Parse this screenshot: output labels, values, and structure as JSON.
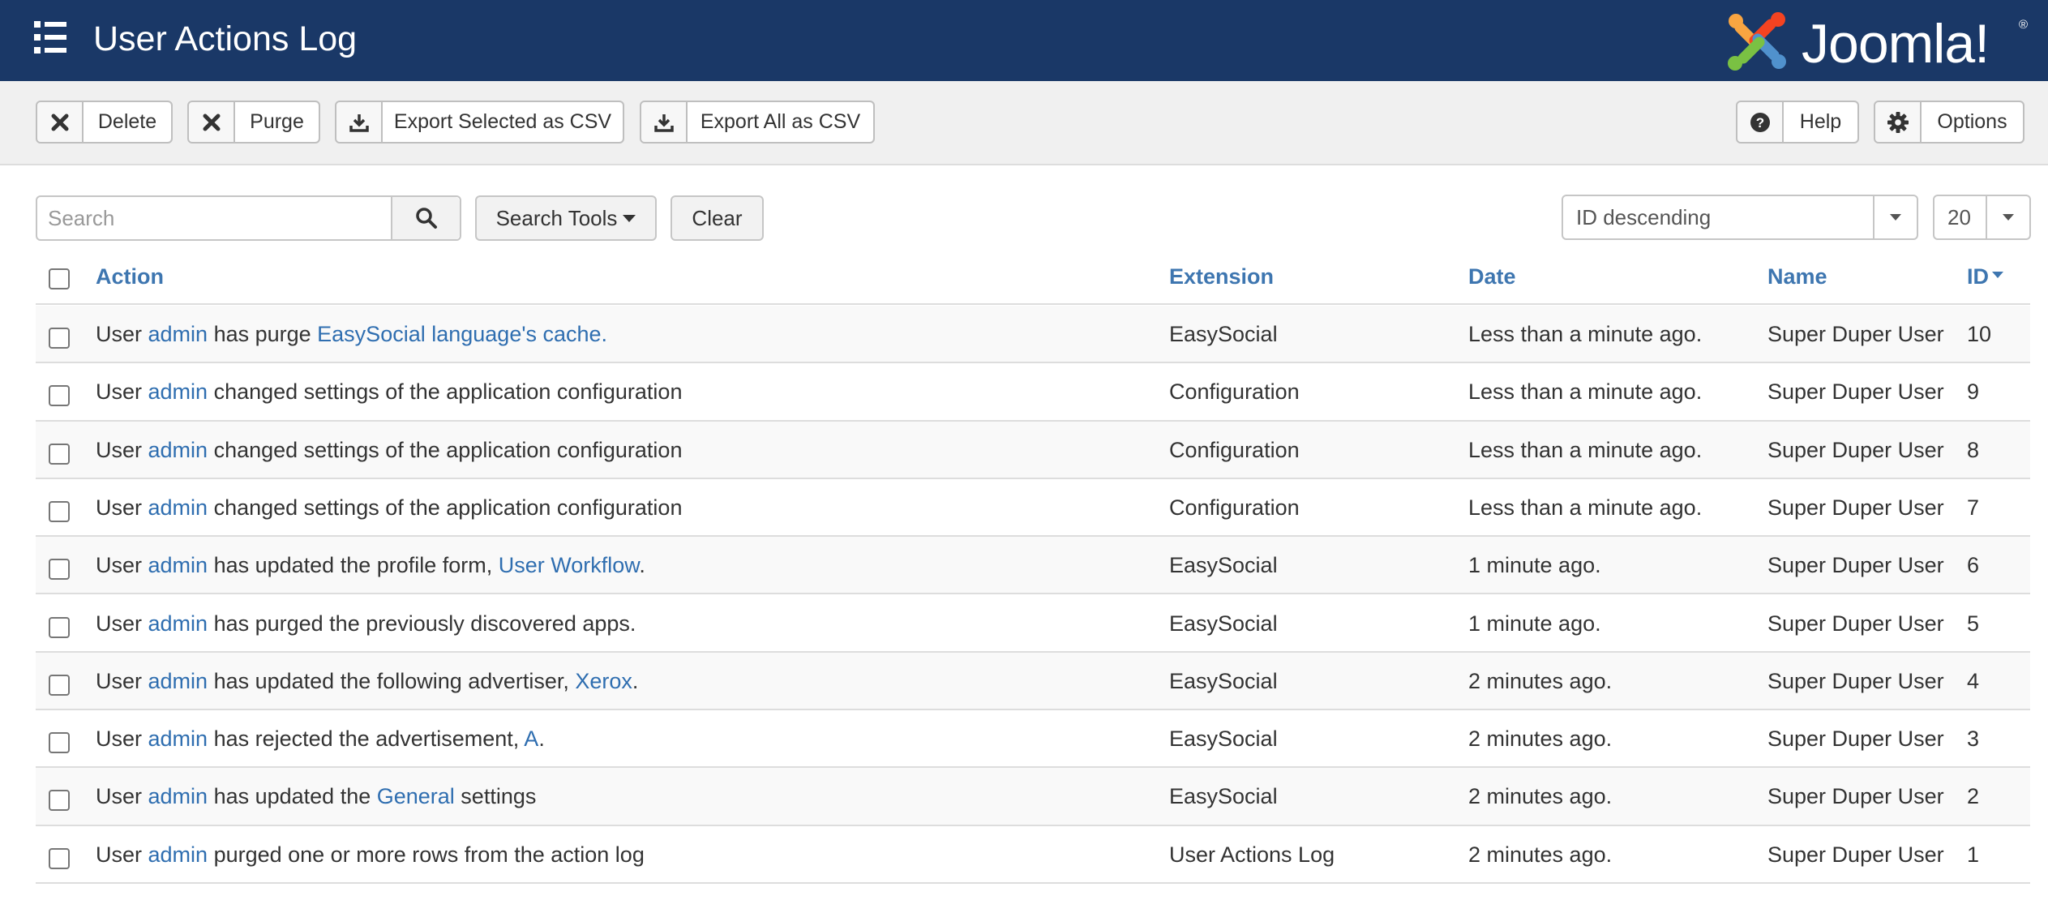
{
  "header": {
    "title": "User Actions Log",
    "brand": "Joomla!",
    "brand_mark": "®",
    "bg_color": "#1a3867"
  },
  "toolbar": {
    "delete_label": "Delete",
    "purge_label": "Purge",
    "export_selected_label": "Export Selected as CSV",
    "export_all_label": "Export All as CSV",
    "help_label": "Help",
    "options_label": "Options"
  },
  "filters": {
    "search_placeholder": "Search",
    "search_tools_label": "Search Tools",
    "clear_label": "Clear",
    "ordering_value": "ID descending",
    "limit_value": "20"
  },
  "table": {
    "columns": {
      "action": "Action",
      "extension": "Extension",
      "date": "Date",
      "name": "Name",
      "id": "ID"
    },
    "link_color": "#2f6eb0",
    "rows": [
      {
        "action": [
          {
            "t": "User "
          },
          {
            "t": "admin",
            "link": true
          },
          {
            "t": " has purge "
          },
          {
            "t": "EasySocial language's cache.",
            "link": true
          }
        ],
        "extension": "EasySocial",
        "date": "Less than a minute ago.",
        "name": "Super Duper User",
        "id": "10"
      },
      {
        "action": [
          {
            "t": "User "
          },
          {
            "t": "admin",
            "link": true
          },
          {
            "t": " changed settings of the application configuration"
          }
        ],
        "extension": "Configuration",
        "date": "Less than a minute ago.",
        "name": "Super Duper User",
        "id": "9"
      },
      {
        "action": [
          {
            "t": "User "
          },
          {
            "t": "admin",
            "link": true
          },
          {
            "t": " changed settings of the application configuration"
          }
        ],
        "extension": "Configuration",
        "date": "Less than a minute ago.",
        "name": "Super Duper User",
        "id": "8"
      },
      {
        "action": [
          {
            "t": "User "
          },
          {
            "t": "admin",
            "link": true
          },
          {
            "t": " changed settings of the application configuration"
          }
        ],
        "extension": "Configuration",
        "date": "Less than a minute ago.",
        "name": "Super Duper User",
        "id": "7"
      },
      {
        "action": [
          {
            "t": "User "
          },
          {
            "t": "admin",
            "link": true
          },
          {
            "t": " has updated the profile form, "
          },
          {
            "t": "User Workflow",
            "link": true
          },
          {
            "t": "."
          }
        ],
        "extension": "EasySocial",
        "date": "1 minute ago.",
        "name": "Super Duper User",
        "id": "6"
      },
      {
        "action": [
          {
            "t": "User "
          },
          {
            "t": "admin",
            "link": true
          },
          {
            "t": " has purged the previously discovered apps."
          }
        ],
        "extension": "EasySocial",
        "date": "1 minute ago.",
        "name": "Super Duper User",
        "id": "5"
      },
      {
        "action": [
          {
            "t": "User "
          },
          {
            "t": "admin",
            "link": true
          },
          {
            "t": " has updated the following advertiser, "
          },
          {
            "t": "Xerox",
            "link": true
          },
          {
            "t": "."
          }
        ],
        "extension": "EasySocial",
        "date": "2 minutes ago.",
        "name": "Super Duper User",
        "id": "4"
      },
      {
        "action": [
          {
            "t": "User "
          },
          {
            "t": "admin",
            "link": true
          },
          {
            "t": " has rejected the advertisement, "
          },
          {
            "t": "A",
            "link": true
          },
          {
            "t": "."
          }
        ],
        "extension": "EasySocial",
        "date": "2 minutes ago.",
        "name": "Super Duper User",
        "id": "3"
      },
      {
        "action": [
          {
            "t": "User "
          },
          {
            "t": "admin",
            "link": true
          },
          {
            "t": " has updated the "
          },
          {
            "t": "General",
            "link": true
          },
          {
            "t": " settings"
          }
        ],
        "extension": "EasySocial",
        "date": "2 minutes ago.",
        "name": "Super Duper User",
        "id": "2"
      },
      {
        "action": [
          {
            "t": "User "
          },
          {
            "t": "admin",
            "link": true
          },
          {
            "t": " purged one or more rows from the action log"
          }
        ],
        "extension": "User Actions Log",
        "date": "2 minutes ago.",
        "name": "Super Duper User",
        "id": "1"
      }
    ]
  }
}
